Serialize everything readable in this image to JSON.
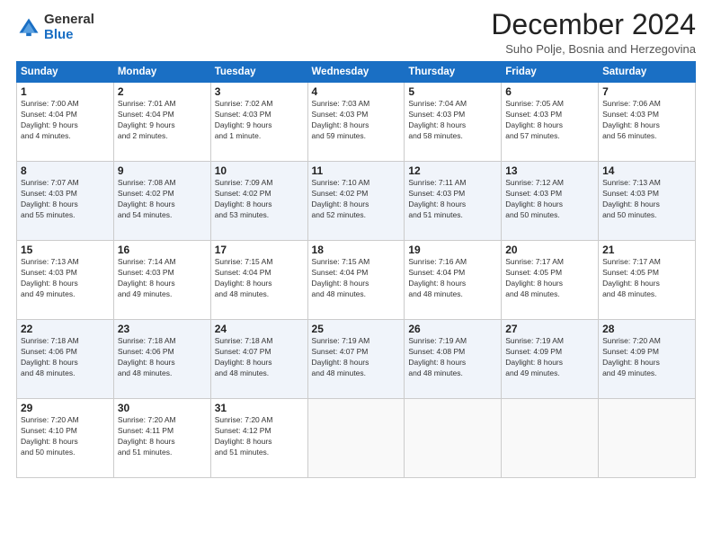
{
  "logo": {
    "general": "General",
    "blue": "Blue"
  },
  "title": "December 2024",
  "subtitle": "Suho Polje, Bosnia and Herzegovina",
  "days_of_week": [
    "Sunday",
    "Monday",
    "Tuesday",
    "Wednesday",
    "Thursday",
    "Friday",
    "Saturday"
  ],
  "weeks": [
    [
      {
        "day": 1,
        "info": "Sunrise: 7:00 AM\nSunset: 4:04 PM\nDaylight: 9 hours\nand 4 minutes."
      },
      {
        "day": 2,
        "info": "Sunrise: 7:01 AM\nSunset: 4:04 PM\nDaylight: 9 hours\nand 2 minutes."
      },
      {
        "day": 3,
        "info": "Sunrise: 7:02 AM\nSunset: 4:03 PM\nDaylight: 9 hours\nand 1 minute."
      },
      {
        "day": 4,
        "info": "Sunrise: 7:03 AM\nSunset: 4:03 PM\nDaylight: 8 hours\nand 59 minutes."
      },
      {
        "day": 5,
        "info": "Sunrise: 7:04 AM\nSunset: 4:03 PM\nDaylight: 8 hours\nand 58 minutes."
      },
      {
        "day": 6,
        "info": "Sunrise: 7:05 AM\nSunset: 4:03 PM\nDaylight: 8 hours\nand 57 minutes."
      },
      {
        "day": 7,
        "info": "Sunrise: 7:06 AM\nSunset: 4:03 PM\nDaylight: 8 hours\nand 56 minutes."
      }
    ],
    [
      {
        "day": 8,
        "info": "Sunrise: 7:07 AM\nSunset: 4:03 PM\nDaylight: 8 hours\nand 55 minutes."
      },
      {
        "day": 9,
        "info": "Sunrise: 7:08 AM\nSunset: 4:02 PM\nDaylight: 8 hours\nand 54 minutes."
      },
      {
        "day": 10,
        "info": "Sunrise: 7:09 AM\nSunset: 4:02 PM\nDaylight: 8 hours\nand 53 minutes."
      },
      {
        "day": 11,
        "info": "Sunrise: 7:10 AM\nSunset: 4:02 PM\nDaylight: 8 hours\nand 52 minutes."
      },
      {
        "day": 12,
        "info": "Sunrise: 7:11 AM\nSunset: 4:03 PM\nDaylight: 8 hours\nand 51 minutes."
      },
      {
        "day": 13,
        "info": "Sunrise: 7:12 AM\nSunset: 4:03 PM\nDaylight: 8 hours\nand 50 minutes."
      },
      {
        "day": 14,
        "info": "Sunrise: 7:13 AM\nSunset: 4:03 PM\nDaylight: 8 hours\nand 50 minutes."
      }
    ],
    [
      {
        "day": 15,
        "info": "Sunrise: 7:13 AM\nSunset: 4:03 PM\nDaylight: 8 hours\nand 49 minutes."
      },
      {
        "day": 16,
        "info": "Sunrise: 7:14 AM\nSunset: 4:03 PM\nDaylight: 8 hours\nand 49 minutes."
      },
      {
        "day": 17,
        "info": "Sunrise: 7:15 AM\nSunset: 4:04 PM\nDaylight: 8 hours\nand 48 minutes."
      },
      {
        "day": 18,
        "info": "Sunrise: 7:15 AM\nSunset: 4:04 PM\nDaylight: 8 hours\nand 48 minutes."
      },
      {
        "day": 19,
        "info": "Sunrise: 7:16 AM\nSunset: 4:04 PM\nDaylight: 8 hours\nand 48 minutes."
      },
      {
        "day": 20,
        "info": "Sunrise: 7:17 AM\nSunset: 4:05 PM\nDaylight: 8 hours\nand 48 minutes."
      },
      {
        "day": 21,
        "info": "Sunrise: 7:17 AM\nSunset: 4:05 PM\nDaylight: 8 hours\nand 48 minutes."
      }
    ],
    [
      {
        "day": 22,
        "info": "Sunrise: 7:18 AM\nSunset: 4:06 PM\nDaylight: 8 hours\nand 48 minutes."
      },
      {
        "day": 23,
        "info": "Sunrise: 7:18 AM\nSunset: 4:06 PM\nDaylight: 8 hours\nand 48 minutes."
      },
      {
        "day": 24,
        "info": "Sunrise: 7:18 AM\nSunset: 4:07 PM\nDaylight: 8 hours\nand 48 minutes."
      },
      {
        "day": 25,
        "info": "Sunrise: 7:19 AM\nSunset: 4:07 PM\nDaylight: 8 hours\nand 48 minutes."
      },
      {
        "day": 26,
        "info": "Sunrise: 7:19 AM\nSunset: 4:08 PM\nDaylight: 8 hours\nand 48 minutes."
      },
      {
        "day": 27,
        "info": "Sunrise: 7:19 AM\nSunset: 4:09 PM\nDaylight: 8 hours\nand 49 minutes."
      },
      {
        "day": 28,
        "info": "Sunrise: 7:20 AM\nSunset: 4:09 PM\nDaylight: 8 hours\nand 49 minutes."
      }
    ],
    [
      {
        "day": 29,
        "info": "Sunrise: 7:20 AM\nSunset: 4:10 PM\nDaylight: 8 hours\nand 50 minutes."
      },
      {
        "day": 30,
        "info": "Sunrise: 7:20 AM\nSunset: 4:11 PM\nDaylight: 8 hours\nand 51 minutes."
      },
      {
        "day": 31,
        "info": "Sunrise: 7:20 AM\nSunset: 4:12 PM\nDaylight: 8 hours\nand 51 minutes."
      },
      null,
      null,
      null,
      null
    ]
  ]
}
